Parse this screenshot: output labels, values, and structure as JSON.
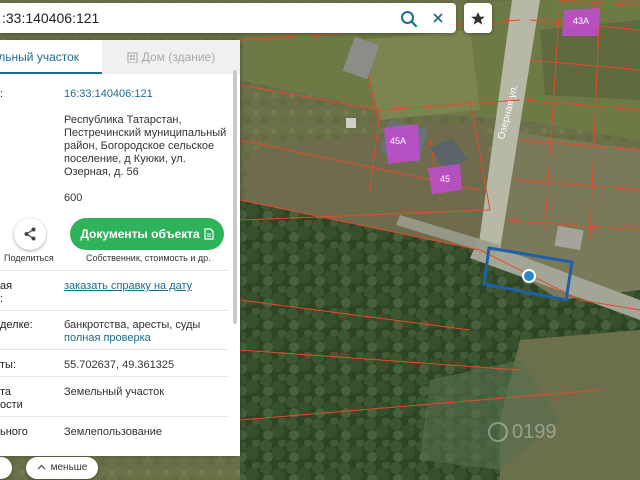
{
  "search": {
    "value": ":33:140406:121"
  },
  "tabs": {
    "land": "ельный участок",
    "building": "Дом (здание)"
  },
  "fields": {
    "cadastre_label": ":",
    "cadastre_value": "16:33:140406:121",
    "address_lines": [
      "Республика Татарстан,",
      "Пестречинский муниципальный",
      "район, Богородское сельское",
      "поселение, д Куюки, ул.",
      "Озерная, д. 56"
    ],
    "area_value": "600",
    "cost_label_1": "ая",
    "cost_label_2": ":",
    "cost_link": "заказать справку на дату",
    "deal_label": "делке:",
    "deal_value": "банкротства, аресты, суды",
    "deal_link": "полная проверка",
    "coords_label": "ты:",
    "coords_value": "55.702637, 49.361325",
    "category_label_1": "та",
    "category_label_2": "ости",
    "category_value": "Земельный участок",
    "use_label": "ьного",
    "use_value": "Землепользование"
  },
  "actions": {
    "share_label": "Поделиться",
    "documents_label": "Документы объекта",
    "documents_sub": "Собственник, стоимость и др."
  },
  "bottom": {
    "less_label": "меньше"
  },
  "map": {
    "street_label": "Озерная ул.",
    "plot_labels": [
      "45А",
      "45",
      "43А"
    ],
    "watermark": "0199",
    "parcel_color": "#1f5fa8",
    "boundary_color": "#e6492a",
    "highlight_color": "#c24bd3"
  },
  "colors": {
    "accent": "#1c6d8c",
    "button_green": "#2eb35a"
  }
}
